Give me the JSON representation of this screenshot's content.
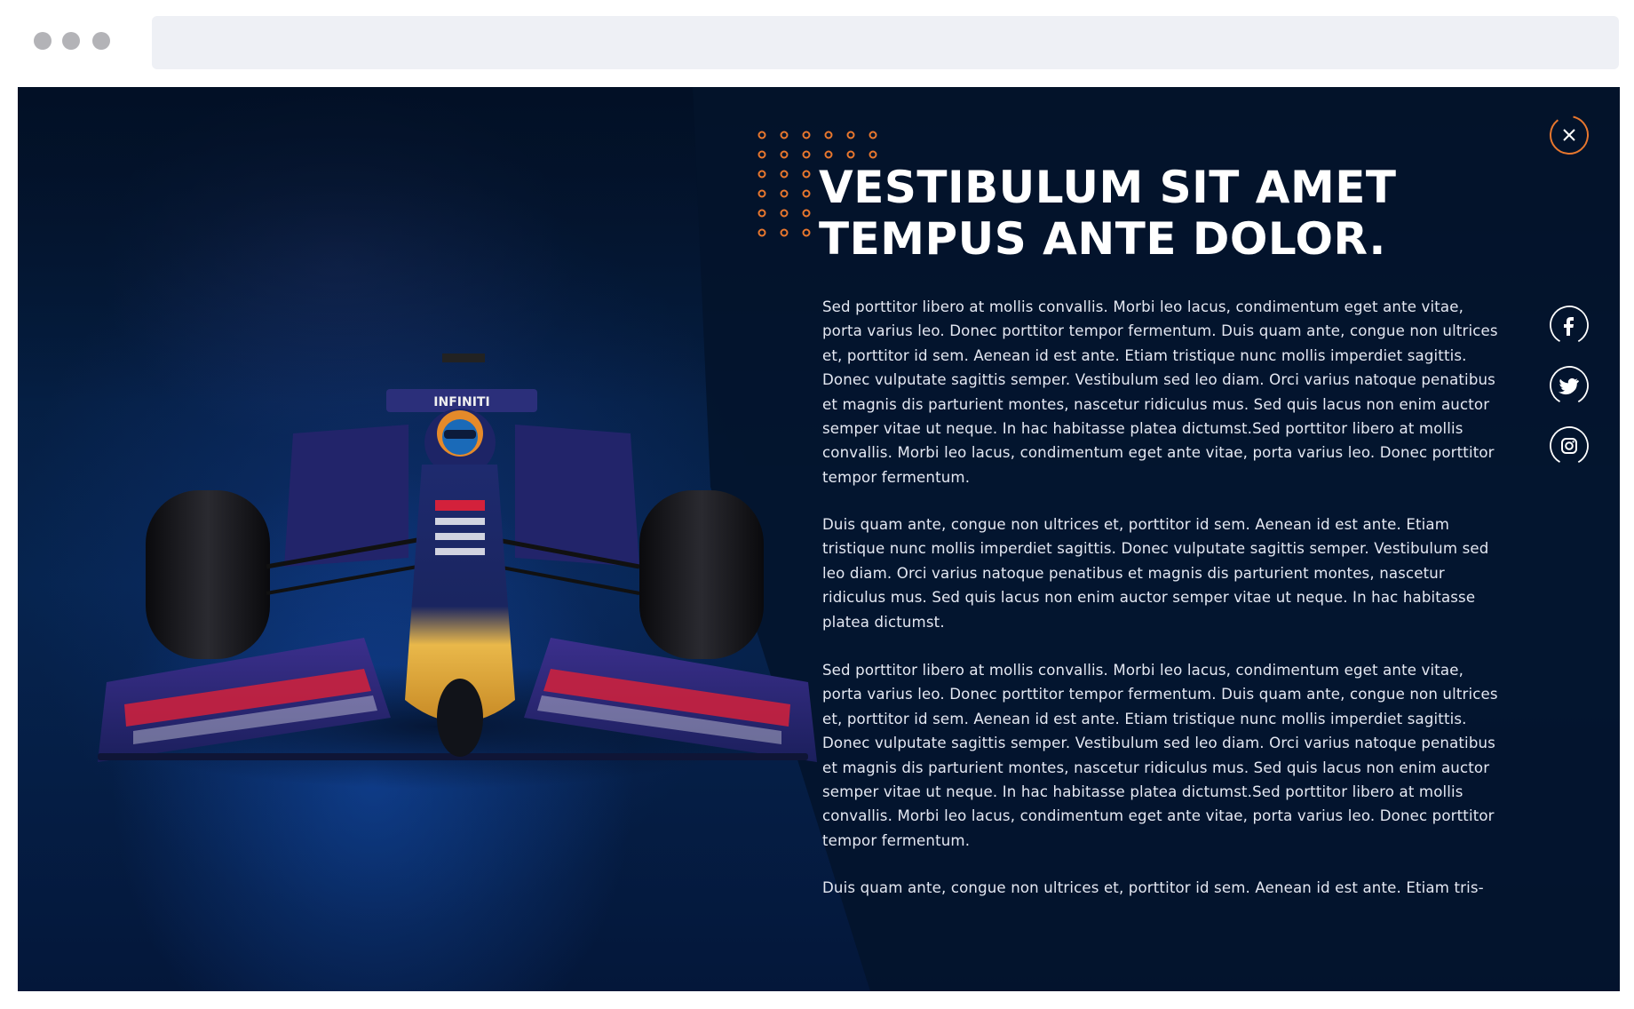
{
  "browser": {
    "window_controls": [
      "dot-1",
      "dot-2",
      "dot-3"
    ],
    "address_value": ""
  },
  "article": {
    "title_line_1": "VESTIBULUM SIT AMET",
    "title_line_2": "TEMPUS ANTE DOLOR.",
    "paragraphs": [
      "Sed porttitor libero at mollis convallis. Morbi leo lacus, condimentum eget ante vitae, porta varius leo. Donec porttitor tempor fermentum. Duis quam ante, congue non ultrices et, porttitor id sem. Aenean id est ante. Etiam tristique nunc mollis imperdiet sagittis. Donec vulputate sagittis semper. Vestibulum sed leo diam. Orci varius natoque penatibus et magnis dis parturient montes, nascetur ridiculus mus. Sed quis lacus non enim auctor semper vitae ut neque. In hac habitasse platea dictumst.Sed porttitor libero at mollis convallis. Morbi leo lacus, condimentum eget ante vitae, porta varius leo. Donec porttitor tempor fermentum.",
      "Duis quam ante, congue non ultrices et, porttitor id sem. Aenean id est ante. Etiam tristique nunc mollis imperdiet sagittis. Donec vulputate sagittis semper. Vestibulum sed leo diam. Orci varius natoque penatibus et magnis dis parturient montes, nascetur ridiculus mus. Sed quis lacus non enim auctor semper vitae ut neque. In hac habitasse platea dictumst.",
      "Sed porttitor libero at mollis convallis. Morbi leo lacus, condimentum eget ante vitae, porta varius leo. Donec porttitor tempor fermentum. Duis quam ante, congue non ultrices et, porttitor id sem. Aenean id est ante. Etiam tristique nunc mollis imperdiet sagittis. Donec vulputate sagittis semper. Vestibulum sed leo diam. Orci varius natoque penatibus et magnis dis parturient montes, nascetur ridiculus mus. Sed quis lacus non enim auctor semper vitae ut neque. In hac habitasse platea dictumst.Sed porttitor libero at mollis convallis. Morbi leo lacus, condimentum eget ante vitae, porta varius leo. Donec porttitor tempor fermentum.",
      "Duis quam ante, congue non ultrices et, porttitor id sem. Aenean id est ante. Etiam tris-"
    ]
  },
  "controls": {
    "close_icon": "close-icon",
    "social": [
      {
        "name": "facebook-icon",
        "glyph": "f"
      },
      {
        "name": "twitter-icon",
        "glyph": "bird"
      },
      {
        "name": "instagram-icon",
        "glyph": "camera"
      }
    ]
  },
  "colors": {
    "accent": "#e8772e",
    "background_dark": "#03132b",
    "background_blue": "#0a3a86",
    "text": "#ffffff"
  }
}
